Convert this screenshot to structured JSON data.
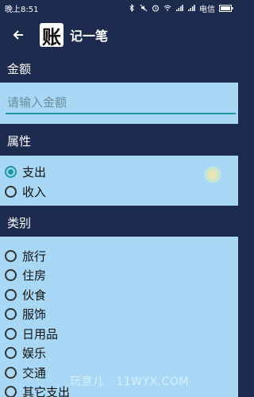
{
  "status_bar": {
    "time": "晚上8:51",
    "carrier": "电信"
  },
  "app_bar": {
    "logo_char": "账",
    "title": "记一笔"
  },
  "amount_section": {
    "header": "金额",
    "placeholder": "请输入金额",
    "value": ""
  },
  "attribute_section": {
    "header": "属性",
    "options": [
      {
        "label": "支出",
        "checked": true
      },
      {
        "label": "收入",
        "checked": false
      }
    ]
  },
  "category_section": {
    "header": "类别",
    "options": [
      {
        "label": "旅行"
      },
      {
        "label": "住房"
      },
      {
        "label": "伙食"
      },
      {
        "label": "服饰"
      },
      {
        "label": "日用品"
      },
      {
        "label": "娱乐"
      },
      {
        "label": "交通"
      },
      {
        "label": "其它支出"
      }
    ]
  },
  "watermark": "玩意儿 · 11WYX.COM",
  "colors": {
    "header_bg": "#1d2b4f",
    "panel_bg": "#a8d8f5",
    "accent": "#1c9aa0"
  }
}
